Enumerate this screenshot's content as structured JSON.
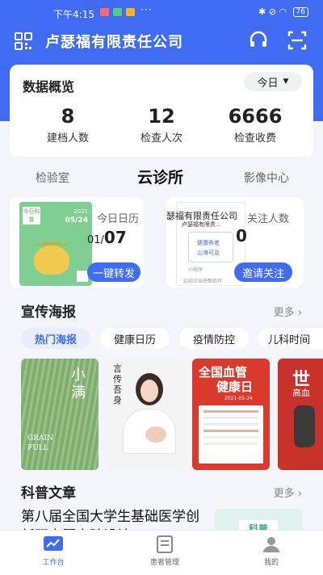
{
  "status_bar": {
    "time": "下午4:15",
    "more": "···",
    "battery": "76"
  },
  "header": {
    "title": "卢瑟福有限责任公司"
  },
  "overview": {
    "title": "数据概览",
    "period": "今日",
    "stats": [
      {
        "value": "8",
        "label": "建档人数"
      },
      {
        "value": "12",
        "label": "检查人次"
      },
      {
        "value": "6666",
        "label": "检查收费"
      }
    ]
  },
  "tabs": [
    "检验室",
    "云诊所",
    "影像中心"
  ],
  "cloud": {
    "left": {
      "thumb_top": "今日科普",
      "thumb_date_year": "2021",
      "thumb_date": "05/24",
      "label": "今日日历",
      "date_month": "01/",
      "date_day": "07",
      "button": "一键转发"
    },
    "right": {
      "company": "瑟福有限责任公司",
      "thumb_sub": "卢瑟福有限责…",
      "thumb_text1": "健康养老",
      "thumb_text2": "山海可及",
      "thumb_mini": "小程序",
      "thumb_note": "以前应当将帮助有",
      "label": "关注人数",
      "value": "0",
      "button": "邀请关注"
    }
  },
  "posters_section": {
    "title": "宣传海报",
    "more": "更多"
  },
  "chips": [
    "热门海报",
    "健康日历",
    "疫情防控",
    "儿科时间"
  ],
  "posters": {
    "p1_big": "小满",
    "p1_en1": "GRAIN",
    "p1_en2": "FULL",
    "p2_text": "言传吾身",
    "p3_title1": "全国血管",
    "p3_title2": "健康日",
    "p3_date": "2021-05-24",
    "p4_title": "世",
    "p4_sub": "高血"
  },
  "articles_section": {
    "title": "科普文章",
    "more": "更多"
  },
  "article": {
    "title": "第八届全国大学生基础医学创新研究暨实验设计",
    "thumb_text": "科普"
  },
  "nav": [
    "工作台",
    "患者管理",
    "我的"
  ],
  "colors": {
    "primary": "#3f6cf2",
    "background": "#f3f5fa"
  }
}
